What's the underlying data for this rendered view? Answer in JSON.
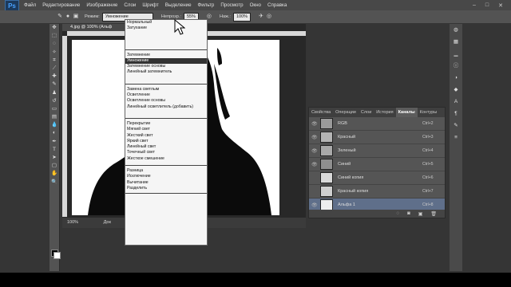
{
  "app": {
    "logo": "Ps",
    "menu": [
      "Файл",
      "Редактирование",
      "Изображение",
      "Слои",
      "Шрифт",
      "Выделение",
      "Фильтр",
      "Просмотр",
      "Окно",
      "Справка"
    ],
    "window_controls": [
      "–",
      "□",
      "✕"
    ]
  },
  "options": {
    "mode_label": "Режим:",
    "mode_value": "Умножение",
    "opacity_label": "Непрозр.:",
    "opacity_value": "55%",
    "flow_label": "Наж.:",
    "flow_value": "100%"
  },
  "document": {
    "tab_title": "4.jpg @ 100% (Альф",
    "zoom": "100%",
    "status_text": "Док"
  },
  "blend_menu": {
    "groups": [
      [
        "Нормальный",
        "Затухание"
      ],
      [
        "Затемнение",
        "Умножение",
        "Затемнение основы",
        "Линейный затемнитель"
      ],
      [
        "Замена светлым",
        "Осветление",
        "Осветление основы",
        "Линейный осветлитель (добавить)"
      ],
      [
        "Перекрытие",
        "Мягкий свет",
        "Жесткий свет",
        "Яркий свет",
        "Линейный свет",
        "Точечный свет",
        "Жесткое смешение"
      ],
      [
        "Разница",
        "Исключение",
        "Вычитание",
        "Разделить"
      ]
    ],
    "selected": "Умножение"
  },
  "channels_panel": {
    "tabs": [
      "Свойства",
      "Операции",
      "Слои",
      "История",
      "Каналы",
      "Контуры"
    ],
    "active_tab": "Каналы",
    "rows": [
      {
        "name": "RGB",
        "shortcut": "Ctrl+2"
      },
      {
        "name": "Красный",
        "shortcut": "Ctrl+3"
      },
      {
        "name": "Зеленый",
        "shortcut": "Ctrl+4"
      },
      {
        "name": "Синий",
        "shortcut": "Ctrl+5"
      },
      {
        "name": "Синий копия",
        "shortcut": "Ctrl+6"
      },
      {
        "name": "Красный копия",
        "shortcut": "Ctrl+7"
      },
      {
        "name": "Альфа 1",
        "shortcut": "Ctrl+8"
      }
    ]
  }
}
